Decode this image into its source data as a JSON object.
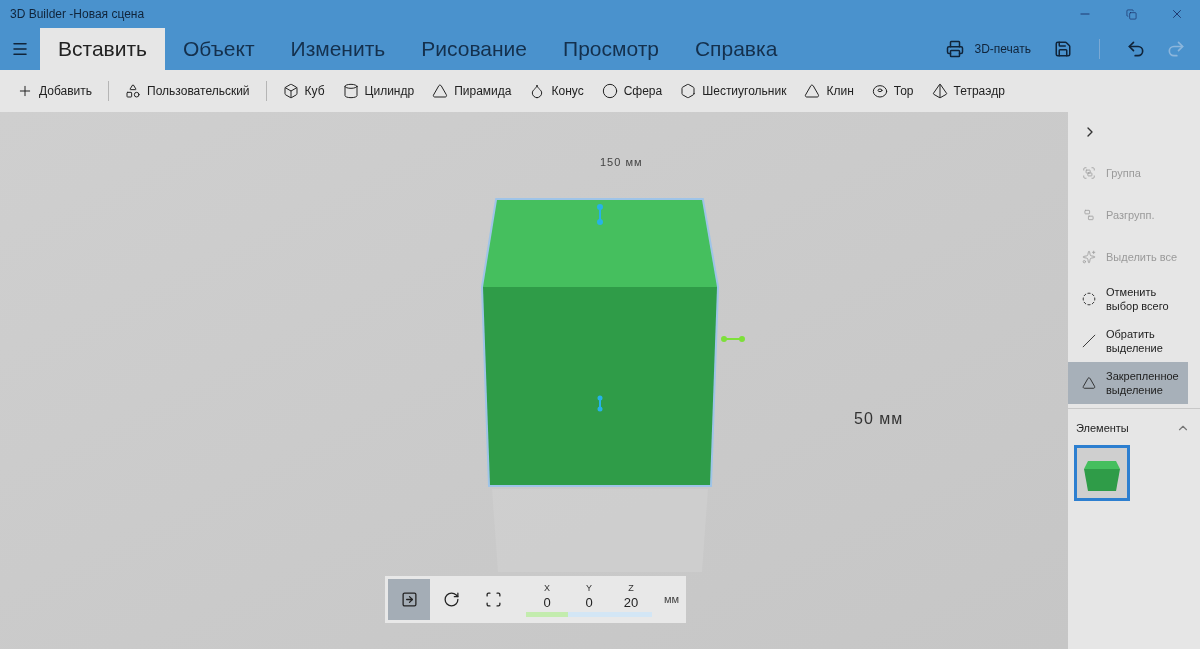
{
  "window": {
    "title": "3D Builder -Новая сцена"
  },
  "tabs": [
    {
      "label": "Вставить",
      "selected": true
    },
    {
      "label": "Объект",
      "selected": false
    },
    {
      "label": "Изменить",
      "selected": false
    },
    {
      "label": "Рисование",
      "selected": false
    },
    {
      "label": "Просмотр",
      "selected": false
    },
    {
      "label": "Справка",
      "selected": false
    }
  ],
  "header_actions": {
    "print_label": "3D-печать",
    "redo_disabled": true
  },
  "toolbar": [
    {
      "kind": "add",
      "label": "Добавить"
    },
    {
      "kind": "custom",
      "label": "Пользовательский"
    },
    {
      "kind": "cube",
      "label": "Куб"
    },
    {
      "kind": "cylinder",
      "label": "Цилиндр"
    },
    {
      "kind": "pyramid",
      "label": "Пирамида"
    },
    {
      "kind": "cone",
      "label": "Конус"
    },
    {
      "kind": "sphere",
      "label": "Сфера"
    },
    {
      "kind": "hexagon",
      "label": "Шестиугольник"
    },
    {
      "kind": "wedge",
      "label": "Клин"
    },
    {
      "kind": "torus",
      "label": "Тор"
    },
    {
      "kind": "tetrahedron",
      "label": "Тетраэдр"
    }
  ],
  "side_panel": {
    "items": [
      {
        "kind": "group",
        "label": "Группа",
        "disabled": true,
        "selected": false
      },
      {
        "kind": "ungroup",
        "label": "Разгрупп.",
        "disabled": true,
        "selected": false
      },
      {
        "kind": "select_all",
        "label": "Выделить все",
        "disabled": true,
        "selected": false
      },
      {
        "kind": "deselect",
        "label": "Отменить выбор всего",
        "disabled": false,
        "selected": false
      },
      {
        "kind": "invert",
        "label": "Обратить выделение",
        "disabled": false,
        "selected": false
      },
      {
        "kind": "locked",
        "label": "Закрепленное выделение",
        "disabled": false,
        "selected": true
      }
    ],
    "elements": {
      "title": "Элементы",
      "expanded": true,
      "items": [
        {
          "selected": true
        }
      ]
    }
  },
  "viewport": {
    "dimension_labels": [
      {
        "text": "150 мм"
      },
      {
        "text": "50 мм"
      }
    ]
  },
  "transform_bar": {
    "tools": [
      {
        "kind": "move",
        "selected": true
      },
      {
        "kind": "rotate",
        "selected": false
      },
      {
        "kind": "scale",
        "selected": false
      }
    ],
    "coordinates": [
      {
        "axis": "X",
        "value": "0",
        "color": "#c3ecae"
      },
      {
        "axis": "Y",
        "value": "0",
        "color": "#d3e6f5"
      },
      {
        "axis": "Z",
        "value": "20",
        "color": "#d3e6f5"
      }
    ],
    "unit": "мм"
  }
}
